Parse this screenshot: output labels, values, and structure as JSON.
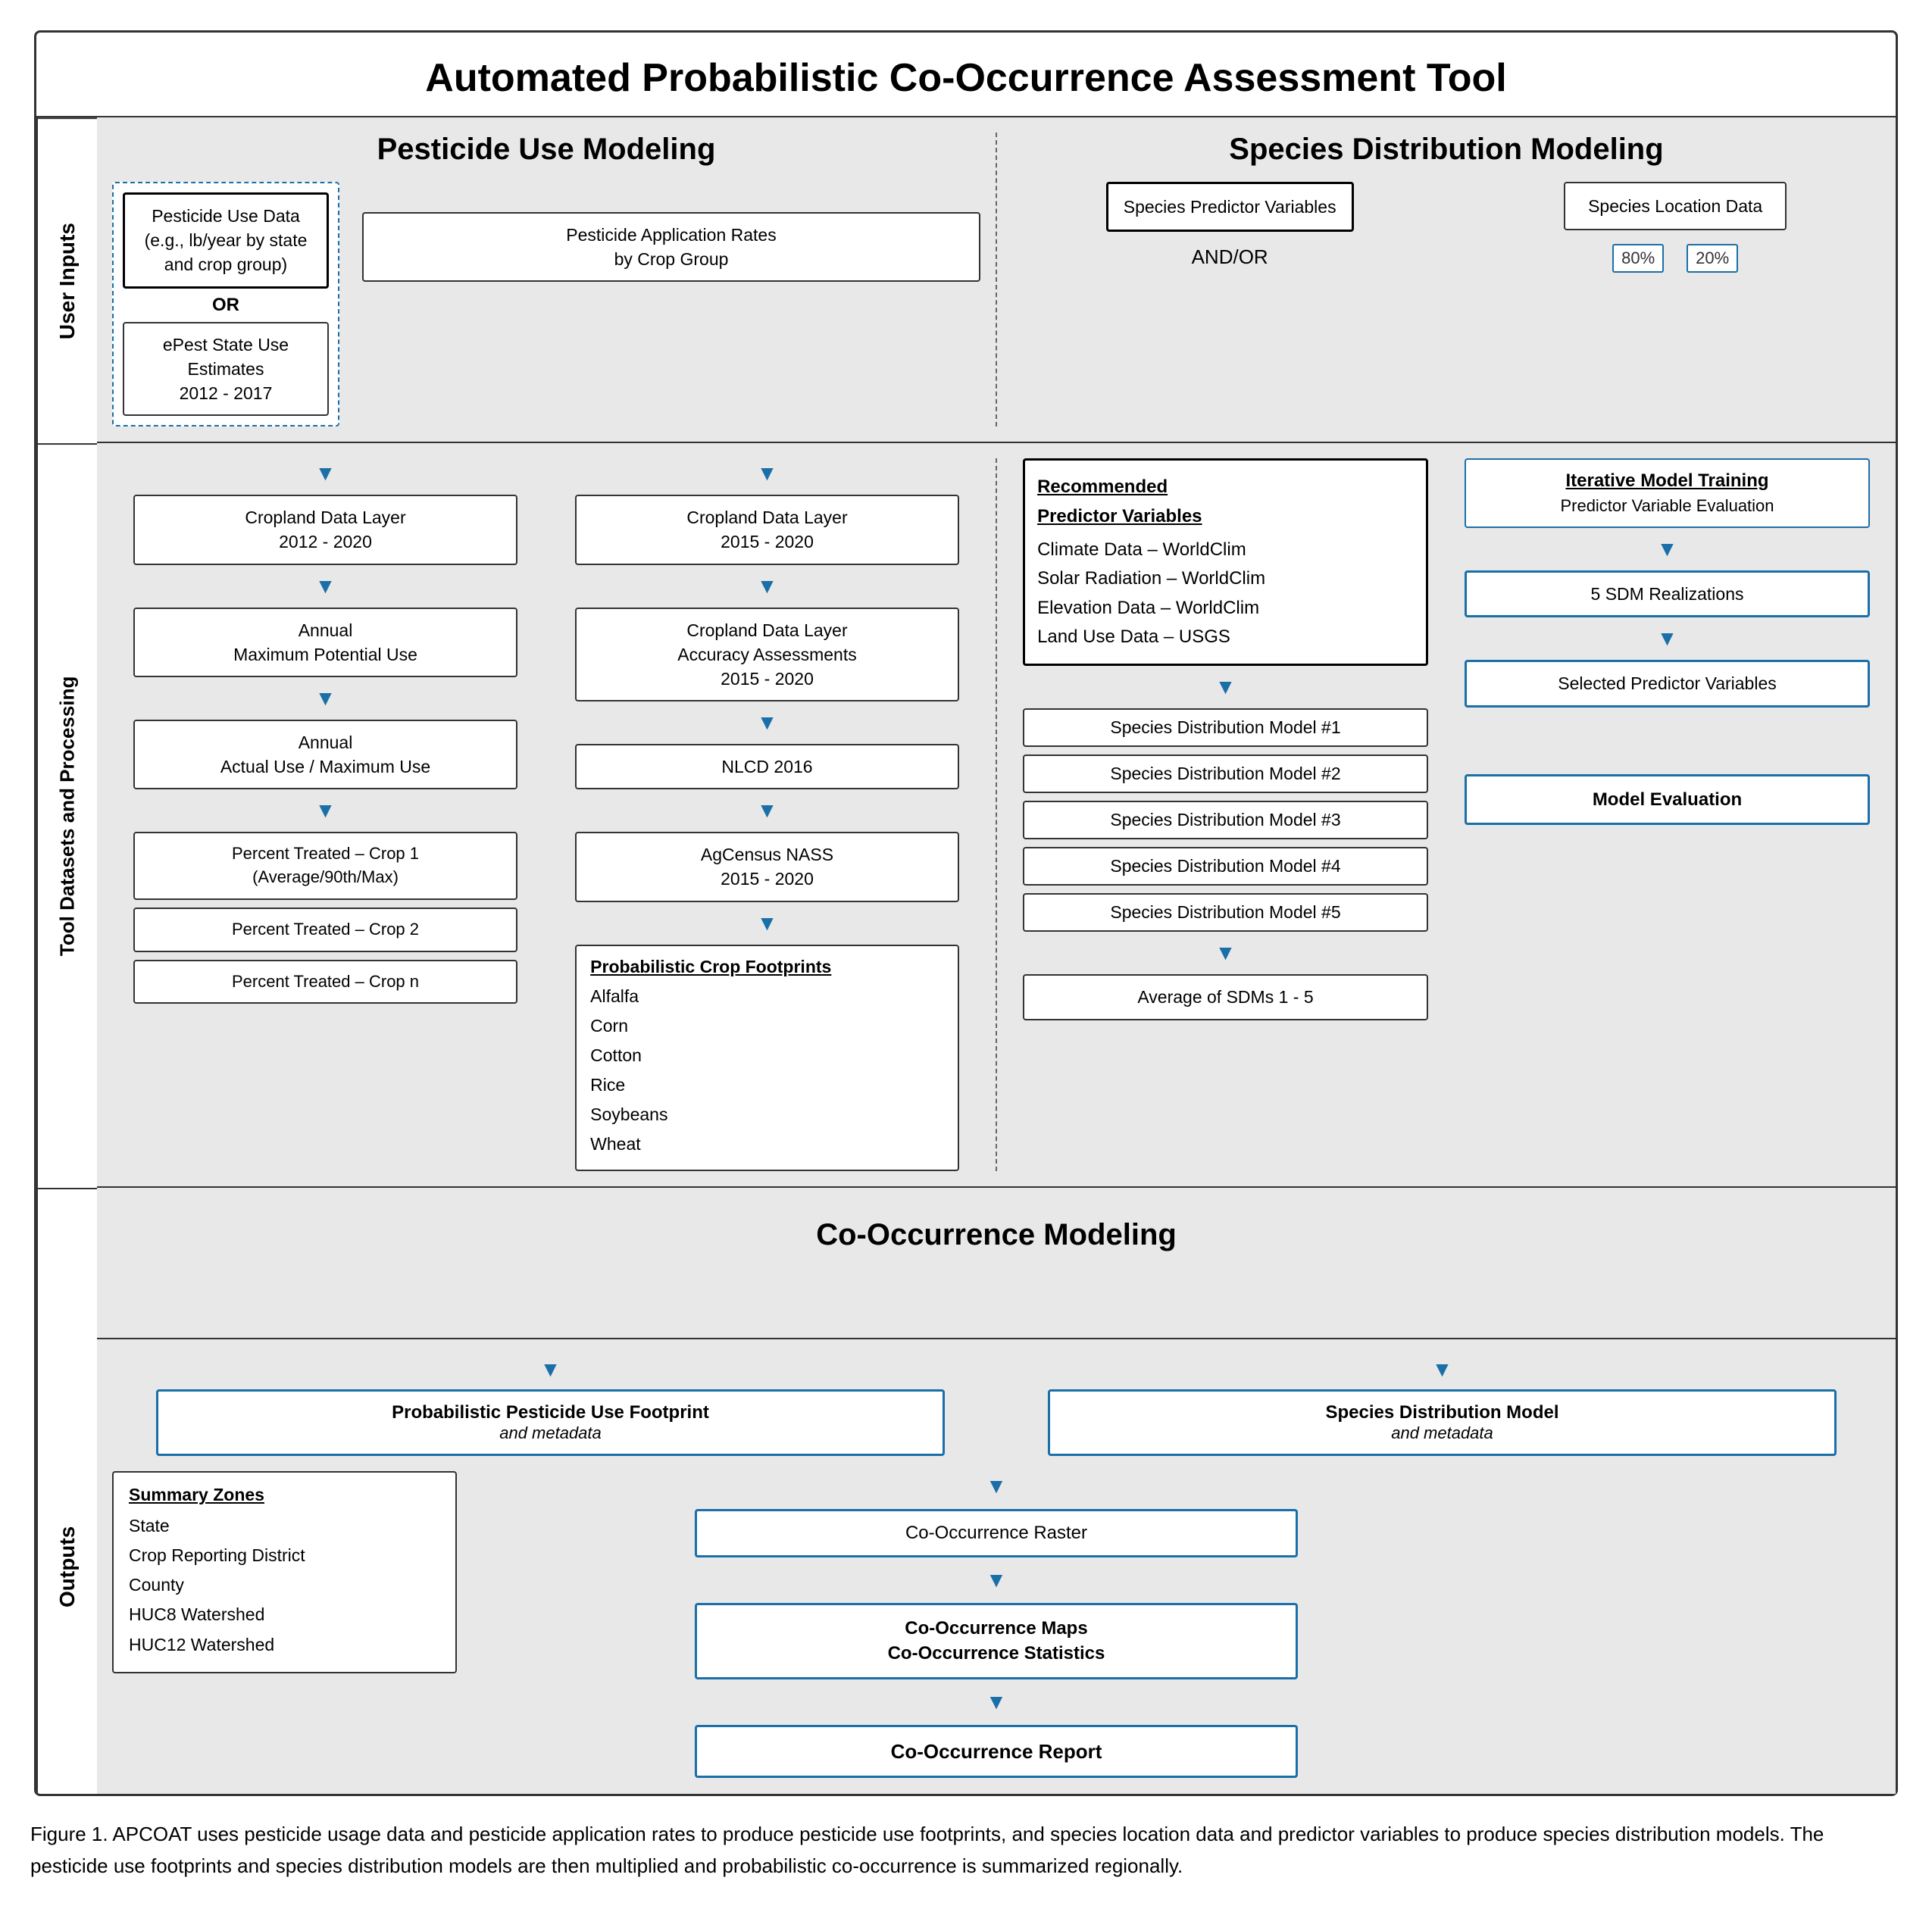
{
  "title": "Automated Probabilistic Co-Occurrence Assessment Tool",
  "section_labels": {
    "user_inputs": "User Inputs",
    "tool_datasets": "Tool Datasets and Processing",
    "outputs": "Outputs"
  },
  "pesticide_header": "Pesticide Use Modeling",
  "species_header": "Species Distribution Modeling",
  "cooccurrence_header": "Co-Occurrence Modeling",
  "user_inputs": {
    "pesticide_use_data": "Pesticide Use Data\n(e.g., lb/year by state\nand crop group)",
    "or_label": "OR",
    "epest": "ePest State Use\nEstimates\n2012 - 2017",
    "pesticide_app_rates": "Pesticide Application Rates\nby Crop Group",
    "species_predictor": "Species Predictor Variables",
    "and_or": "AND/OR",
    "species_location": "Species Location Data",
    "pct_80": "80%",
    "pct_20": "20%"
  },
  "tool_datasets": {
    "cropland_2012_2020": "Cropland Data Layer\n2012 - 2020",
    "annual_max_potential": "Annual\nMaximum Potential Use",
    "annual_actual": "Annual\nActual Use / Maximum Use",
    "pct_crop1": "Percent Treated – Crop 1\n(Average/90th/Max)",
    "pct_crop2": "Percent Treated – Crop 2",
    "pct_cropn": "Percent Treated – Crop n",
    "cropland_2015_2020": "Cropland Data Layer\n2015 - 2020",
    "cropland_accuracy": "Cropland Data Layer\nAccuracy Assessments\n2015 - 2020",
    "nlcd": "NLCD 2016",
    "agcensus": "AgCensus NASS\n2015 - 2020",
    "prob_crop_footprints": "Probabilistic Crop Footprints",
    "crops": [
      "Alfalfa",
      "Corn",
      "Cotton",
      "Rice",
      "Soybeans",
      "Wheat"
    ],
    "recommended_title": "Recommended\nPredictor Variables",
    "climate_data": "Climate Data – WorldClim",
    "solar_radiation": "Solar Radiation – WorldClim",
    "elevation": "Elevation Data – WorldClim",
    "land_use": "Land Use Data – USGS",
    "iterative_model": "Iterative Model Training",
    "predictor_eval": "Predictor Variable Evaluation",
    "sdm_realizations": "5 SDM Realizations",
    "selected_predictor": "Selected Predictor Variables",
    "sdm_models": [
      "Species Distribution Model #1",
      "Species Distribution Model #2",
      "Species Distribution Model #3",
      "Species Distribution Model #4",
      "Species Distribution Model #5"
    ],
    "model_evaluation": "Model Evaluation",
    "average_sdms": "Average of SDMs 1 - 5"
  },
  "outputs": {
    "prob_pesticide_footprint": "Probabilistic Pesticide Use Footprint",
    "and_metadata_1": "and metadata",
    "species_dist_model": "Species Distribution Model",
    "and_metadata_2": "and metadata",
    "summary_zones_title": "Summary Zones",
    "summary_zones": [
      "State",
      "Crop Reporting District",
      "County",
      "HUC8 Watershed",
      "HUC12 Watershed"
    ],
    "cooc_raster": "Co-Occurrence Raster",
    "cooc_maps": "Co-Occurrence Maps\nCo-Occurrence Statistics",
    "cooc_report": "Co-Occurrence Report"
  },
  "caption": "Figure 1. APCOAT uses pesticide usage data and pesticide application rates to produce pesticide use footprints, and species location data and predictor variables to produce species distribution models. The pesticide use footprints and species distribution models are then multiplied and probabilistic co-occurrence is summarized regionally."
}
